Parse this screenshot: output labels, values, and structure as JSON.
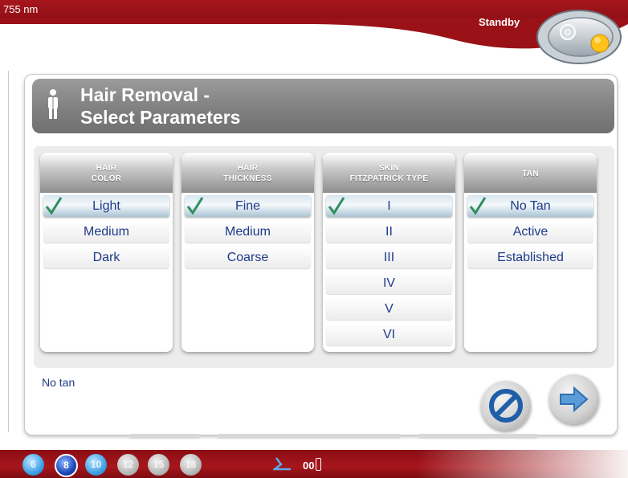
{
  "top": {
    "wavelength": "755 nm",
    "status": "Standby",
    "standby_icon": "standby-toggle-icon"
  },
  "header": {
    "title_line1": "Hair Removal -",
    "title_line2": "Select Parameters",
    "icon": "person-icon"
  },
  "columns": [
    {
      "header_line1": "HAIR",
      "header_line2": "COLOR",
      "options": [
        "Light",
        "Medium",
        "Dark"
      ],
      "selected": "Light"
    },
    {
      "header_line1": "HAIR",
      "header_line2": "THICKNESS",
      "options": [
        "Fine",
        "Medium",
        "Coarse"
      ],
      "selected": "Fine"
    },
    {
      "header_line1": "SKIN",
      "header_line2": "FITZPATRICK TYPE",
      "options": [
        "I",
        "II",
        "III",
        "IV",
        "V",
        "VI"
      ],
      "selected": "I"
    },
    {
      "header_line1": "TAN",
      "header_line2": "",
      "options": [
        "No Tan",
        "Active",
        "Established"
      ],
      "selected": "No Tan"
    }
  ],
  "note": "No tan",
  "buttons": {
    "cancel_icon": "cancel-icon",
    "next_icon": "arrow-right-icon"
  },
  "bottom": {
    "spot_sizes": [
      "6",
      "8",
      "10",
      "12",
      "15",
      "18"
    ],
    "active_spot": "8",
    "counter": "00"
  },
  "colors": {
    "brand_red": "#9a1218",
    "text_blue": "#1e3a8a",
    "check_green": "#2f8f5b"
  }
}
